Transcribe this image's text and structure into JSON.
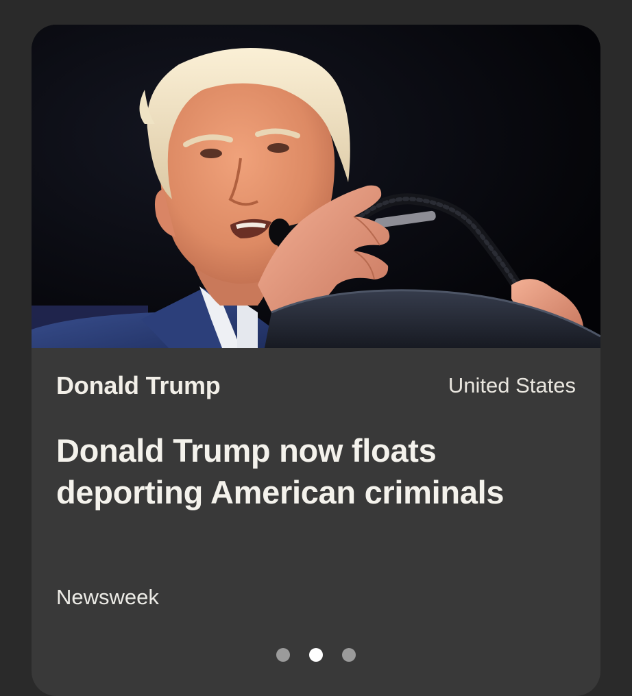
{
  "card": {
    "image": {
      "description": "Donald Trump speaking at a podium microphone against a dark background"
    },
    "topic": "Donald Trump",
    "region": "United States",
    "headline": "Donald Trump now floats deporting American criminals",
    "source": "Newsweek"
  },
  "pagination": {
    "total": 3,
    "active_index": 1
  },
  "colors": {
    "page_background": "#2a2a2a",
    "card_background": "#393939",
    "text_primary": "#f4f2ec",
    "dot_inactive": "#9b9b9b",
    "dot_active": "#ffffff"
  }
}
